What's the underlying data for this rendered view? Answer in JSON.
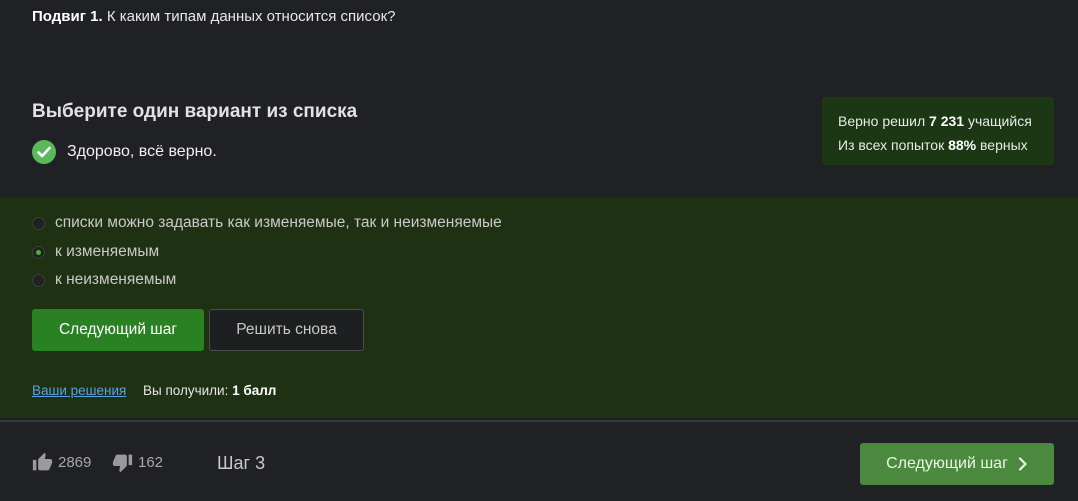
{
  "question": {
    "label": "Подвиг 1.",
    "text": "К каким типам данных относится список?"
  },
  "choose_title": "Выберите один вариант из списка",
  "result": {
    "text": "Здорово, всё верно.",
    "icon": "check-circle-icon"
  },
  "stats": {
    "solved_prefix": "Верно решил",
    "solved_count": "7 231",
    "solved_suffix": "учащийся",
    "attempts_prefix": "Из всех попыток",
    "attempts_percent": "88%",
    "attempts_suffix": "верных"
  },
  "options": [
    {
      "label": "списки можно задавать как изменяемые, так и неизменяемые",
      "selected": false
    },
    {
      "label": "к изменяемым",
      "selected": true
    },
    {
      "label": "к неизменяемым",
      "selected": false
    }
  ],
  "buttons": {
    "next_step": "Следующий шаг",
    "retry": "Решить снова"
  },
  "solutions_link": "Ваши решения",
  "score": {
    "prefix": "Вы получили:",
    "value": "1 балл"
  },
  "footer": {
    "likes": "2869",
    "dislikes": "162",
    "step": "Шаг 3",
    "next_step": "Следующий шаг"
  },
  "colors": {
    "background": "#202125",
    "answers_background": "#1e3113",
    "accent_green": "#2a8124",
    "check_green": "#5cb85c",
    "link_blue": "#5aa0e6"
  }
}
